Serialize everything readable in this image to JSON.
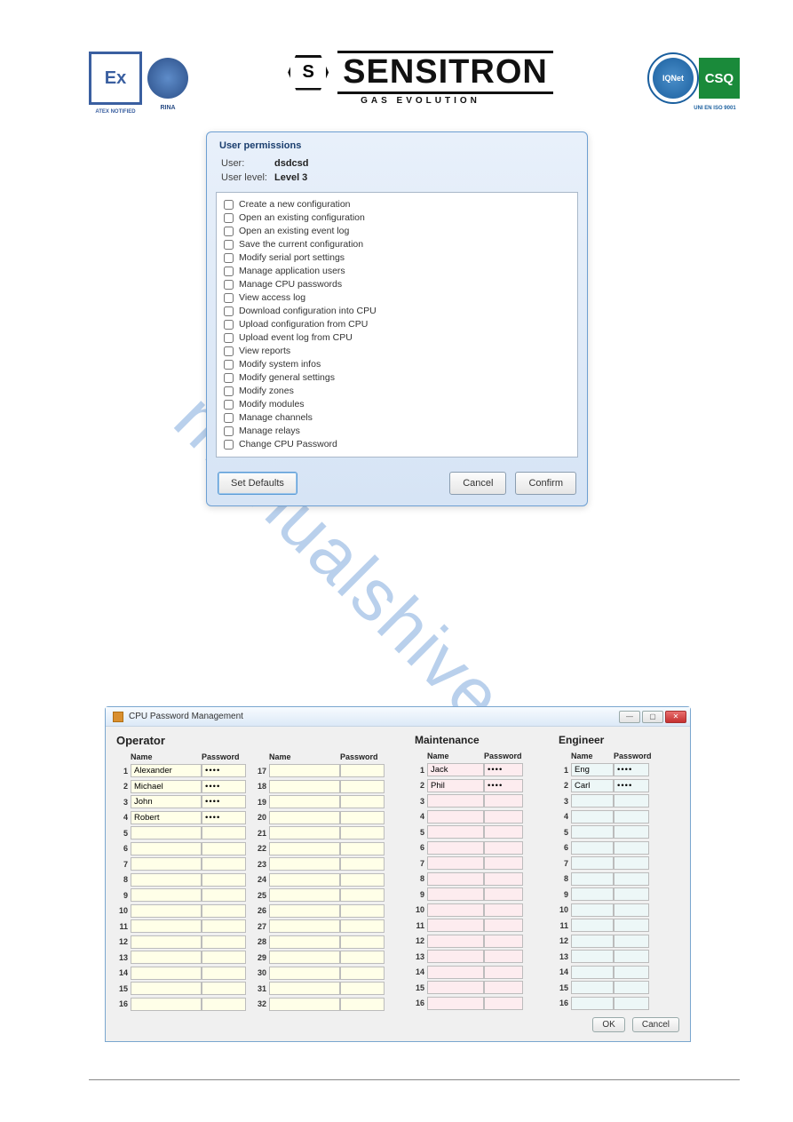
{
  "header": {
    "atex_label": "ATEX NOTIFIED",
    "atex_text": "Ex",
    "rina_label": "RINA",
    "sensitron_hex": "S",
    "sensitron_word": "SENSITRON",
    "sensitron_tag": "GAS EVOLUTION",
    "iqnet_text": "IQNet",
    "csq_text": "CSQ",
    "csq_label": "UNI EN ISO 9001"
  },
  "watermark": "manualshive.com",
  "dialog1": {
    "title": "User permissions",
    "user_label": "User:",
    "user_value": "dsdcsd",
    "level_label": "User level:",
    "level_value": "Level 3",
    "permissions": [
      "Create a new configuration",
      "Open an existing configuration",
      "Open an existing event log",
      "Save the current configuration",
      "Modify serial port settings",
      "Manage application users",
      "Manage CPU passwords",
      "View access log",
      "Download configuration into CPU",
      "Upload configuration from CPU",
      "Upload event log from CPU",
      "View reports",
      "Modify system infos",
      "Modify general settings",
      "Modify zones",
      "Modify modules",
      "Manage channels",
      "Manage relays",
      "Change CPU Password"
    ],
    "set_defaults": "Set Defaults",
    "cancel": "Cancel",
    "confirm": "Confirm"
  },
  "dialog2": {
    "title": "CPU Password Management",
    "headers": {
      "operator": "Operator",
      "maintenance": "Maintenance",
      "engineer": "Engineer",
      "name": "Name",
      "password": "Password"
    },
    "operator_rows_a": [
      {
        "n": "1",
        "name": "Alexander",
        "pwd": "••••"
      },
      {
        "n": "2",
        "name": "Michael",
        "pwd": "••••"
      },
      {
        "n": "3",
        "name": "John",
        "pwd": "••••"
      },
      {
        "n": "4",
        "name": "Robert",
        "pwd": "••••"
      },
      {
        "n": "5",
        "name": "",
        "pwd": ""
      },
      {
        "n": "6",
        "name": "",
        "pwd": ""
      },
      {
        "n": "7",
        "name": "",
        "pwd": ""
      },
      {
        "n": "8",
        "name": "",
        "pwd": ""
      },
      {
        "n": "9",
        "name": "",
        "pwd": ""
      },
      {
        "n": "10",
        "name": "",
        "pwd": ""
      },
      {
        "n": "11",
        "name": "",
        "pwd": ""
      },
      {
        "n": "12",
        "name": "",
        "pwd": ""
      },
      {
        "n": "13",
        "name": "",
        "pwd": ""
      },
      {
        "n": "14",
        "name": "",
        "pwd": ""
      },
      {
        "n": "15",
        "name": "",
        "pwd": ""
      },
      {
        "n": "16",
        "name": "",
        "pwd": ""
      }
    ],
    "operator_rows_b": [
      {
        "n": "17",
        "name": "",
        "pwd": ""
      },
      {
        "n": "18",
        "name": "",
        "pwd": ""
      },
      {
        "n": "19",
        "name": "",
        "pwd": ""
      },
      {
        "n": "20",
        "name": "",
        "pwd": ""
      },
      {
        "n": "21",
        "name": "",
        "pwd": ""
      },
      {
        "n": "22",
        "name": "",
        "pwd": ""
      },
      {
        "n": "23",
        "name": "",
        "pwd": ""
      },
      {
        "n": "24",
        "name": "",
        "pwd": ""
      },
      {
        "n": "25",
        "name": "",
        "pwd": ""
      },
      {
        "n": "26",
        "name": "",
        "pwd": ""
      },
      {
        "n": "27",
        "name": "",
        "pwd": ""
      },
      {
        "n": "28",
        "name": "",
        "pwd": ""
      },
      {
        "n": "29",
        "name": "",
        "pwd": ""
      },
      {
        "n": "30",
        "name": "",
        "pwd": ""
      },
      {
        "n": "31",
        "name": "",
        "pwd": ""
      },
      {
        "n": "32",
        "name": "",
        "pwd": ""
      }
    ],
    "maintenance_rows": [
      {
        "n": "1",
        "name": "Jack",
        "pwd": "••••"
      },
      {
        "n": "2",
        "name": "Phil",
        "pwd": "••••"
      },
      {
        "n": "3",
        "name": "",
        "pwd": ""
      },
      {
        "n": "4",
        "name": "",
        "pwd": ""
      },
      {
        "n": "5",
        "name": "",
        "pwd": ""
      },
      {
        "n": "6",
        "name": "",
        "pwd": ""
      },
      {
        "n": "7",
        "name": "",
        "pwd": ""
      },
      {
        "n": "8",
        "name": "",
        "pwd": ""
      },
      {
        "n": "9",
        "name": "",
        "pwd": ""
      },
      {
        "n": "10",
        "name": "",
        "pwd": ""
      },
      {
        "n": "11",
        "name": "",
        "pwd": ""
      },
      {
        "n": "12",
        "name": "",
        "pwd": ""
      },
      {
        "n": "13",
        "name": "",
        "pwd": ""
      },
      {
        "n": "14",
        "name": "",
        "pwd": ""
      },
      {
        "n": "15",
        "name": "",
        "pwd": ""
      },
      {
        "n": "16",
        "name": "",
        "pwd": ""
      }
    ],
    "engineer_rows": [
      {
        "n": "1",
        "name": "Eng",
        "pwd": "••••"
      },
      {
        "n": "2",
        "name": "Carl",
        "pwd": "••••"
      },
      {
        "n": "3",
        "name": "",
        "pwd": ""
      },
      {
        "n": "4",
        "name": "",
        "pwd": ""
      },
      {
        "n": "5",
        "name": "",
        "pwd": ""
      },
      {
        "n": "6",
        "name": "",
        "pwd": ""
      },
      {
        "n": "7",
        "name": "",
        "pwd": ""
      },
      {
        "n": "8",
        "name": "",
        "pwd": ""
      },
      {
        "n": "9",
        "name": "",
        "pwd": ""
      },
      {
        "n": "10",
        "name": "",
        "pwd": ""
      },
      {
        "n": "11",
        "name": "",
        "pwd": ""
      },
      {
        "n": "12",
        "name": "",
        "pwd": ""
      },
      {
        "n": "13",
        "name": "",
        "pwd": ""
      },
      {
        "n": "14",
        "name": "",
        "pwd": ""
      },
      {
        "n": "15",
        "name": "",
        "pwd": ""
      },
      {
        "n": "16",
        "name": "",
        "pwd": ""
      }
    ],
    "ok": "OK",
    "cancel": "Cancel"
  }
}
